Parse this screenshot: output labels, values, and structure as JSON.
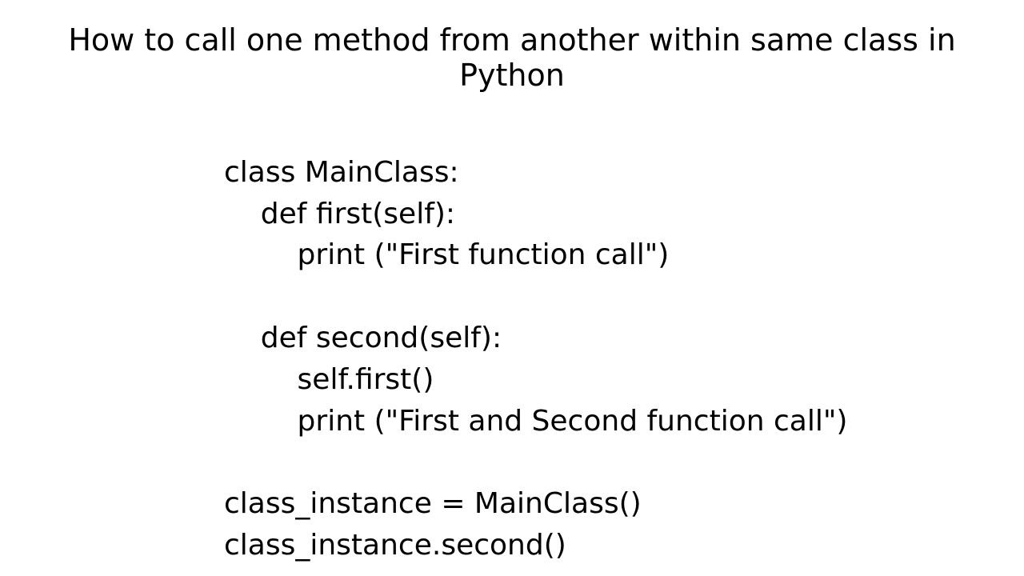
{
  "title": "How to call one method from another within same class in Python",
  "code": {
    "line1": "class MainClass:",
    "line2": "    def first(self):",
    "line3": "        print (\"First function call\")",
    "line4": "",
    "line5": "    def second(self):",
    "line6": "        self.first()",
    "line7": "        print (\"First and Second function call\")",
    "line8": "",
    "line9": "class_instance = MainClass()",
    "line10": "class_instance.second()"
  }
}
